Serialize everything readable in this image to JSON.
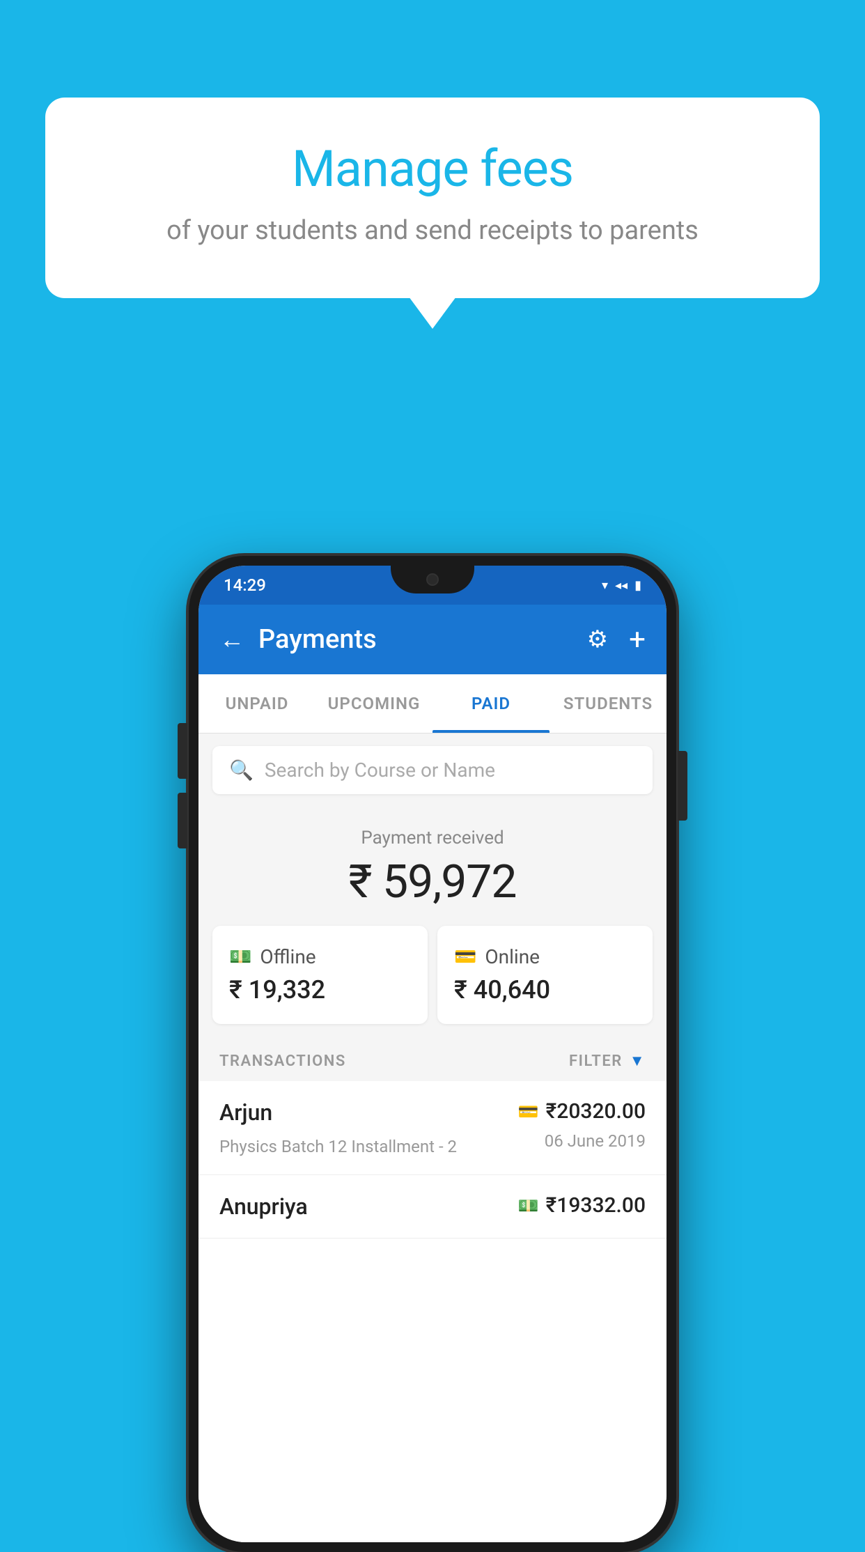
{
  "background_color": "#1ab6e8",
  "speech_bubble": {
    "title": "Manage fees",
    "subtitle": "of your students and send receipts to parents"
  },
  "status_bar": {
    "time": "14:29",
    "icons": [
      "wifi",
      "signal",
      "battery"
    ]
  },
  "nav": {
    "title": "Payments",
    "back_label": "←",
    "settings_label": "⚙",
    "add_label": "+"
  },
  "tabs": [
    {
      "label": "UNPAID",
      "active": false
    },
    {
      "label": "UPCOMING",
      "active": false
    },
    {
      "label": "PAID",
      "active": true
    },
    {
      "label": "STUDENTS",
      "active": false
    }
  ],
  "search": {
    "placeholder": "Search by Course or Name"
  },
  "payment_summary": {
    "label": "Payment received",
    "total": "₹ 59,972",
    "offline": {
      "label": "Offline",
      "amount": "₹ 19,332"
    },
    "online": {
      "label": "Online",
      "amount": "₹ 40,640"
    }
  },
  "transactions": {
    "section_label": "TRANSACTIONS",
    "filter_label": "FILTER",
    "items": [
      {
        "name": "Arjun",
        "detail": "Physics Batch 12 Installment - 2",
        "amount": "₹20320.00",
        "date": "06 June 2019",
        "mode": "card"
      },
      {
        "name": "Anupriya",
        "detail": "",
        "amount": "₹19332.00",
        "date": "",
        "mode": "cash"
      }
    ]
  }
}
